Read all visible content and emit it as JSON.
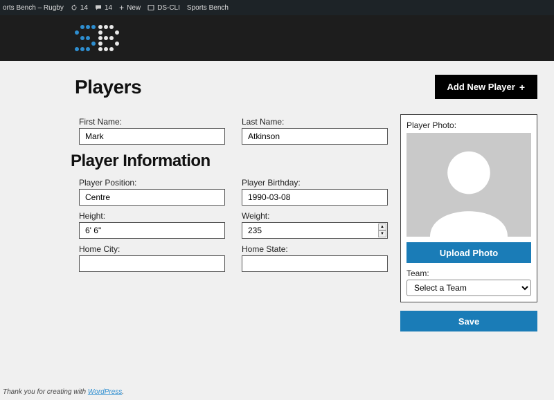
{
  "adminBar": {
    "siteName": "orts Bench – Rugby",
    "updates": "14",
    "comments": "14",
    "new": "New",
    "dscli": "DS-CLI",
    "sportsBench": "Sports Bench"
  },
  "page": {
    "title": "Players",
    "addNew": "Add New Player"
  },
  "labels": {
    "firstName": "First Name:",
    "lastName": "Last Name:",
    "playerInfo": "Player Information",
    "position": "Player Position:",
    "birthday": "Player Birthday:",
    "height": "Height:",
    "weight": "Weight:",
    "homeCity": "Home City:",
    "homeState": "Home State:",
    "playerPhoto": "Player Photo:",
    "uploadPhoto": "Upload Photo",
    "team": "Team:",
    "save": "Save"
  },
  "form": {
    "firstName": "Mark",
    "lastName": "Atkinson",
    "position": "Centre",
    "birthday": "1990-03-08",
    "height": "6' 6\"",
    "weight": "235",
    "homeCity": "",
    "homeState": "",
    "teamSelected": "Select a Team"
  },
  "footer": {
    "prefix": "Thank you for creating with ",
    "link": "WordPress",
    "suffix": "."
  }
}
